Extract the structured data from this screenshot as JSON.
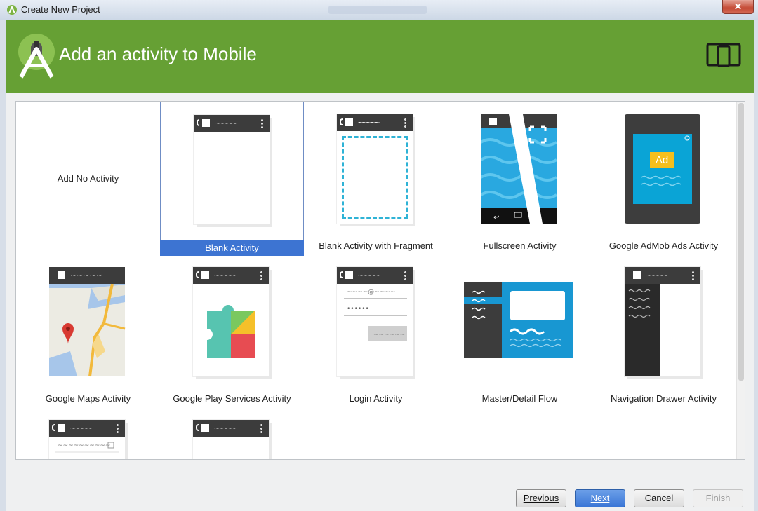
{
  "window": {
    "title": "Create New Project",
    "close_glyph": "✕"
  },
  "header": {
    "title": "Add an activity to Mobile"
  },
  "colors": {
    "header": "#66a034",
    "selection": "#3d74d2",
    "phone_bar": "#3c3c3c"
  },
  "icons": {
    "app": "android-studio-icon",
    "header_logo": "android-studio-logo",
    "device": "phone-tablet-icon"
  },
  "tiles": [
    {
      "label": "Add No Activity"
    },
    {
      "label": "Blank Activity",
      "selected": true
    },
    {
      "label": "Blank Activity with Fragment"
    },
    {
      "label": "Fullscreen Activity"
    },
    {
      "label": "Google AdMob Ads Activity"
    },
    {
      "label": "Google Maps Activity"
    },
    {
      "label": "Google Play Services Activity"
    },
    {
      "label": "Login Activity"
    },
    {
      "label": "Master/Detail Flow"
    },
    {
      "label": "Navigation Drawer Activity"
    }
  ],
  "ad_badge": "Ad",
  "buttons": {
    "previous": "Previous",
    "next": "Next",
    "cancel": "Cancel",
    "finish": "Finish"
  }
}
